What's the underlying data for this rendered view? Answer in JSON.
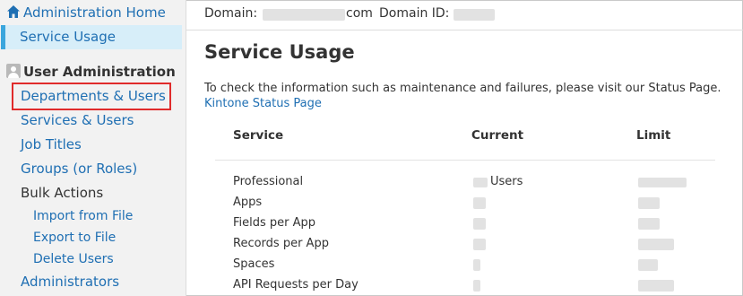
{
  "sidebar": {
    "home_label": "Administration Home",
    "service_usage_label": "Service Usage",
    "section_label": "User Administration",
    "items": [
      {
        "label": "Departments & Users"
      },
      {
        "label": "Services & Users"
      },
      {
        "label": "Job Titles"
      },
      {
        "label": "Groups (or Roles)"
      }
    ],
    "bulk_label": "Bulk Actions",
    "bulk_items": [
      {
        "label": "Import from File"
      },
      {
        "label": "Export to File"
      },
      {
        "label": "Delete Users"
      }
    ],
    "administrators_label": "Administrators"
  },
  "header": {
    "domain_label": "Domain:",
    "domain_suffix": "com",
    "domain_id_label": "Domain ID:"
  },
  "page": {
    "title": "Service Usage",
    "description": "To check the information such as maintenance and failures, please visit our Status Page.",
    "status_link": "Kintone Status Page"
  },
  "table": {
    "headers": {
      "service": "Service",
      "current": "Current",
      "limit": "Limit"
    },
    "rows": [
      {
        "service": "Professional",
        "current_unit": "Users"
      },
      {
        "service": "Apps"
      },
      {
        "service": "Fields per App"
      },
      {
        "service": "Records per App"
      },
      {
        "service": "Spaces"
      },
      {
        "service": "API Requests per Day"
      }
    ]
  },
  "colors": {
    "link": "#1f6fb3",
    "selected_bg": "#d7eef9",
    "selected_accent": "#3aa6dd",
    "highlight_border": "#e02b2b",
    "sidebar_bg": "#f2f2f2"
  },
  "icons": {
    "home": "home-icon",
    "user_admin": "user-admin-icon"
  }
}
